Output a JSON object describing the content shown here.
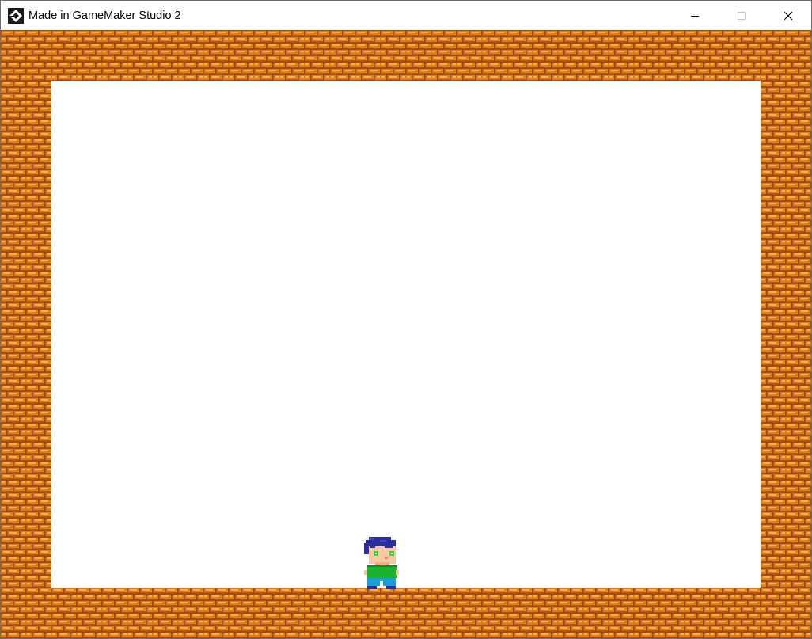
{
  "window": {
    "title": "Made in GameMaker Studio 2",
    "app_icon": "gamemaker-icon",
    "controls": {
      "minimize": "minimize-icon",
      "maximize": "maximize-icon",
      "close": "close-icon"
    }
  },
  "game": {
    "background_color": "#ffffff",
    "wall_tile": "brick",
    "brick_colors": {
      "mortar": "#9c4a28",
      "brick": "#e0800a",
      "highlight": "#f6b25a"
    },
    "player": {
      "sprite": "boy-blue-hair-green-shirt",
      "hair_color": "#2b2f9a",
      "shirt_color": "#19b42c",
      "pants_color": "#1aa0d6",
      "skin_color": "#f7c8a4",
      "eye_color": "#30e030"
    }
  }
}
